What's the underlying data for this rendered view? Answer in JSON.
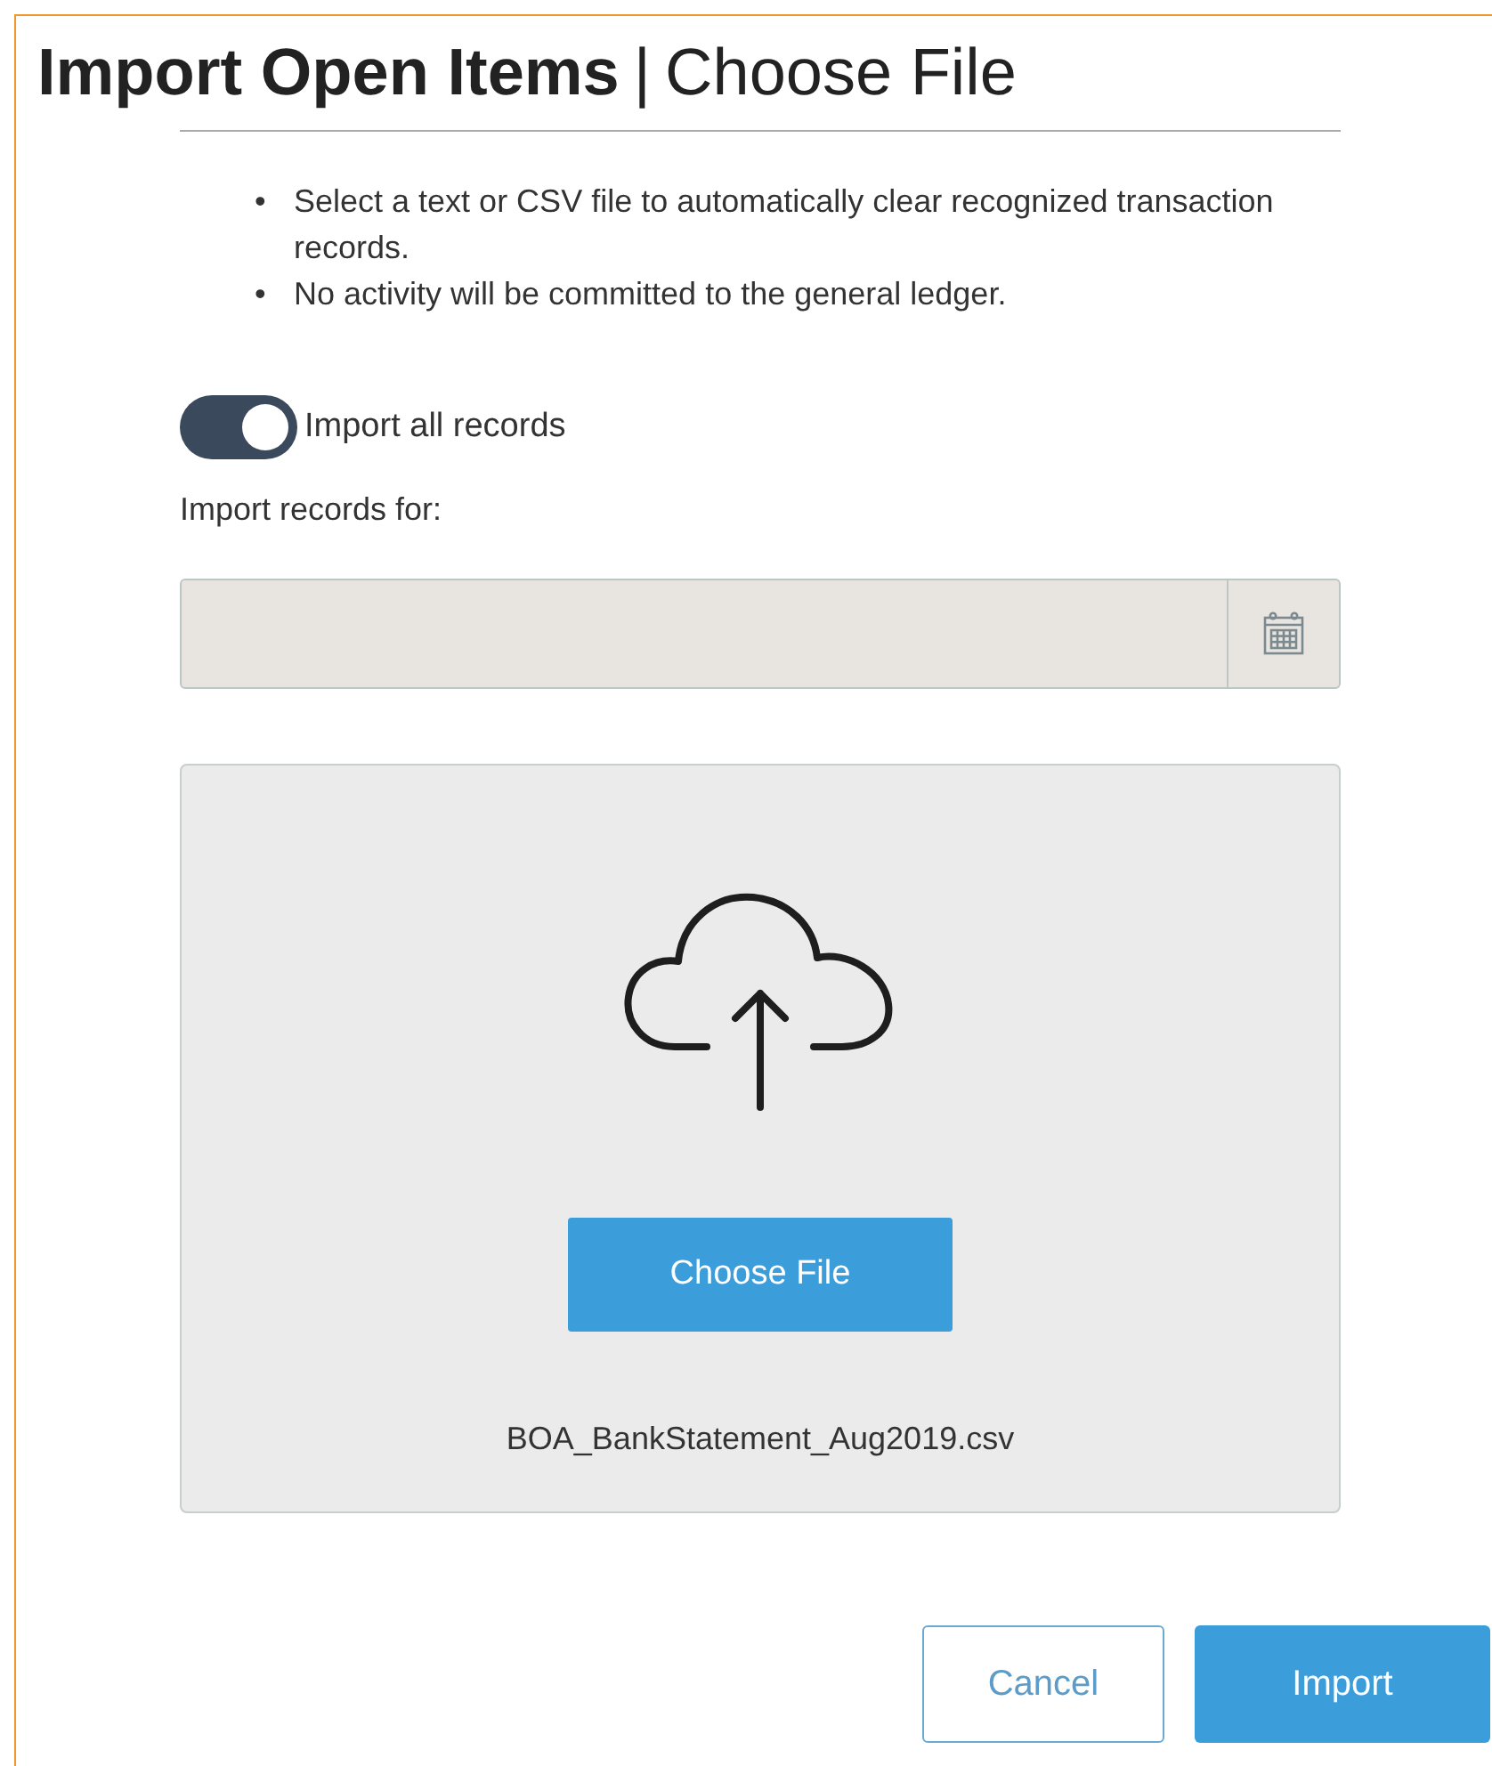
{
  "title": {
    "main": "Import Open Items",
    "separator": "|",
    "sub": "Choose File"
  },
  "notes": [
    {
      "bullet": "•",
      "text": "Select a text or CSV file to automatically clear recognized transaction records."
    },
    {
      "bullet": "•",
      "text": "No activity will be committed to the general ledger."
    }
  ],
  "toggle": {
    "label": "Import all records",
    "on": true
  },
  "date_field": {
    "label": "Import records for:",
    "disabled": true
  },
  "dropzone": {
    "button": "Choose File",
    "file_name": "BOA_BankStatement_Aug2019.csv"
  },
  "buttons": [
    {
      "label": "Cancel",
      "kind": "secondary"
    },
    {
      "label": "Import",
      "kind": "primary"
    }
  ]
}
